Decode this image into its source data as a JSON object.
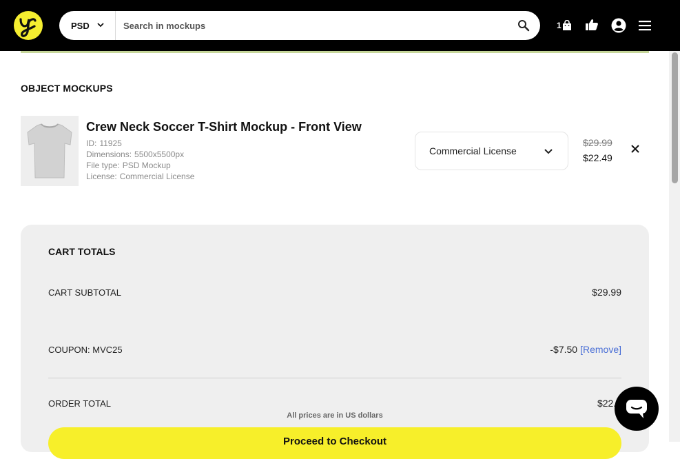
{
  "header": {
    "format_selected": "PSD",
    "search_placeholder": "Search in mockups",
    "cart_count": "1"
  },
  "section": {
    "title": "OBJECT MOCKUPS"
  },
  "item": {
    "title": "Crew Neck Soccer T-Shirt Mockup - Front View",
    "id_label": "ID:",
    "id_value": "11925",
    "dimensions_label": "Dimensions:",
    "dimensions_value": "5500x5500px",
    "filetype_label": "File type:",
    "filetype_value": "PSD Mockup",
    "license_label": "License:",
    "license_value": "Commercial License",
    "license_selected": "Commercial License",
    "old_price": "$29.99",
    "new_price": "$22.49"
  },
  "totals": {
    "title": "CART TOTALS",
    "subtotal_label": "CART SUBTOTAL",
    "subtotal_value": "$29.99",
    "coupon_label": "COUPON: MVC25",
    "coupon_value": "-$7.50",
    "remove_label": "[Remove]",
    "order_total_label": "ORDER TOTAL",
    "order_total_value": "$22.4",
    "usd_note": "All prices are in US dollars",
    "checkout_label": "Proceed to Checkout"
  },
  "colors": {
    "brand_yellow": "#f5ee30",
    "header_bg": "#000000",
    "link_blue": "#4a6fd6"
  }
}
